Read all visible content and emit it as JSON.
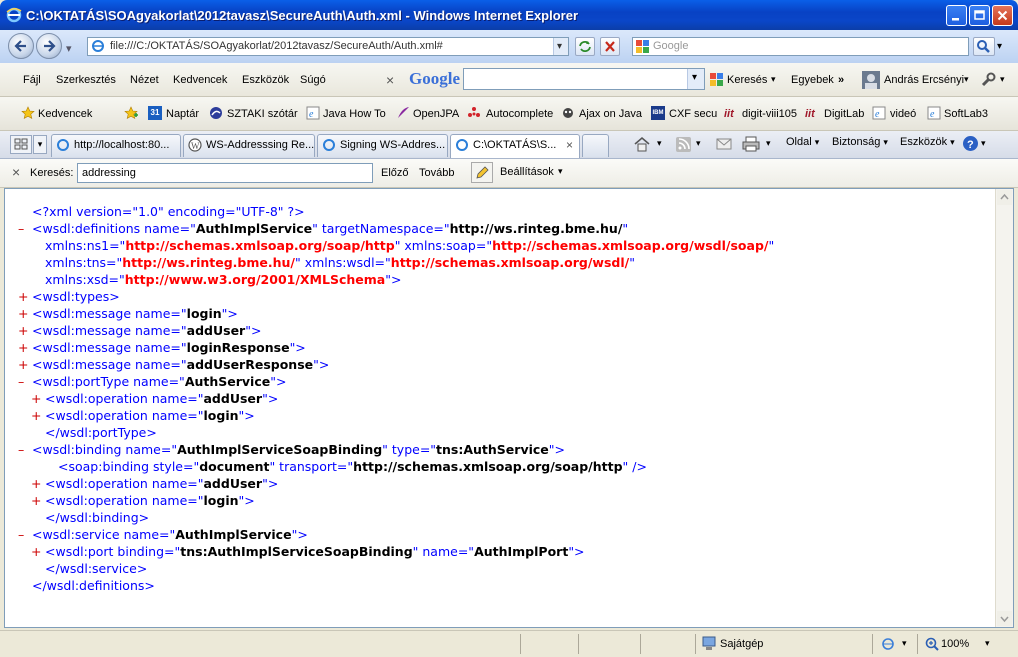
{
  "window": {
    "title": "C:\\OKTATÁS\\SOAgyakorlat\\2012tavasz\\SecureAuth\\Auth.xml - Windows Internet Explorer"
  },
  "address": {
    "url": "file:///C:/OKTATÁS/SOAgyakorlat/2012tavasz/SecureAuth/Auth.xml#",
    "search_placeholder": "Google"
  },
  "menu": {
    "items": [
      "Fájl",
      "Szerkesztés",
      "Nézet",
      "Kedvencek",
      "Eszközök",
      "Súgó"
    ],
    "google_logo": "Google",
    "search_button": "Keresés",
    "more_button": "Egyebek",
    "user_name": "András Ercsényi"
  },
  "favorites": {
    "label": "Kedvencek",
    "items": [
      "Naptár",
      "SZTAKI szótár",
      "Java How To",
      "OpenJPA",
      "Autocomplete",
      "Ajax on Java",
      "CXF secu",
      "digit-viii105",
      "DigitLab",
      "videó",
      "SoftLab3"
    ],
    "calendar_day": "31",
    "ibm_badge": "IBM"
  },
  "tabs": {
    "items": [
      "http://localhost:80...",
      "WS-Addresssing Re...",
      "Signing WS-Addres...",
      "C:\\OKTATÁS\\S..."
    ],
    "toolbar": [
      "Oldal",
      "Biztonság",
      "Eszközök"
    ]
  },
  "find": {
    "label": "Keresés:",
    "value": "addressing",
    "prev": "Előző",
    "next": "Tovább",
    "settings": "Beállítások"
  },
  "xml_lines": [
    {
      "indent": 0,
      "marker": "",
      "parts": [
        {
          "c": "b",
          "t": "<?xml version=\"1.0\" encoding=\"UTF-8\" ?>"
        }
      ]
    },
    {
      "indent": 0,
      "marker": "–",
      "parts": [
        {
          "c": "b",
          "t": "<wsdl:definitions name=\""
        },
        {
          "c": "v",
          "t": "AuthImplService"
        },
        {
          "c": "b",
          "t": "\" targetNamespace=\""
        },
        {
          "c": "v",
          "t": "http://ws.rinteg.bme.hu/"
        },
        {
          "c": "b",
          "t": "\""
        }
      ]
    },
    {
      "indent": 1,
      "marker": "",
      "parts": [
        {
          "c": "b",
          "t": "xmlns:ns1=\""
        },
        {
          "c": "vr",
          "t": "http://schemas.xmlsoap.org/soap/http"
        },
        {
          "c": "b",
          "t": "\" xmlns:soap=\""
        },
        {
          "c": "vr",
          "t": "http://schemas.xmlsoap.org/wsdl/soap/"
        },
        {
          "c": "b",
          "t": "\""
        }
      ]
    },
    {
      "indent": 1,
      "marker": "",
      "parts": [
        {
          "c": "b",
          "t": "xmlns:tns=\""
        },
        {
          "c": "vr",
          "t": "http://ws.rinteg.bme.hu/"
        },
        {
          "c": "b",
          "t": "\" xmlns:wsdl=\""
        },
        {
          "c": "vr",
          "t": "http://schemas.xmlsoap.org/wsdl/"
        },
        {
          "c": "b",
          "t": "\""
        }
      ]
    },
    {
      "indent": 1,
      "marker": "",
      "parts": [
        {
          "c": "b",
          "t": "xmlns:xsd=\""
        },
        {
          "c": "vr",
          "t": "http://www.w3.org/2001/XMLSchema"
        },
        {
          "c": "b",
          "t": "\">"
        }
      ]
    },
    {
      "indent": 0,
      "marker": "+",
      "parts": [
        {
          "c": "b",
          "t": "<wsdl:types>"
        }
      ]
    },
    {
      "indent": 0,
      "marker": "+",
      "parts": [
        {
          "c": "b",
          "t": "<wsdl:message name=\""
        },
        {
          "c": "v",
          "t": "login"
        },
        {
          "c": "b",
          "t": "\">"
        }
      ]
    },
    {
      "indent": 0,
      "marker": "+",
      "parts": [
        {
          "c": "b",
          "t": "<wsdl:message name=\""
        },
        {
          "c": "v",
          "t": "addUser"
        },
        {
          "c": "b",
          "t": "\">"
        }
      ]
    },
    {
      "indent": 0,
      "marker": "+",
      "parts": [
        {
          "c": "b",
          "t": "<wsdl:message name=\""
        },
        {
          "c": "v",
          "t": "loginResponse"
        },
        {
          "c": "b",
          "t": "\">"
        }
      ]
    },
    {
      "indent": 0,
      "marker": "+",
      "parts": [
        {
          "c": "b",
          "t": "<wsdl:message name=\""
        },
        {
          "c": "v",
          "t": "addUserResponse"
        },
        {
          "c": "b",
          "t": "\">"
        }
      ]
    },
    {
      "indent": 0,
      "marker": "–",
      "parts": [
        {
          "c": "b",
          "t": "<wsdl:portType name=\""
        },
        {
          "c": "v",
          "t": "AuthService"
        },
        {
          "c": "b",
          "t": "\">"
        }
      ]
    },
    {
      "indent": 1,
      "marker": "+",
      "parts": [
        {
          "c": "b",
          "t": "<wsdl:operation name=\""
        },
        {
          "c": "v",
          "t": "addUser"
        },
        {
          "c": "b",
          "t": "\">"
        }
      ]
    },
    {
      "indent": 1,
      "marker": "+",
      "parts": [
        {
          "c": "b",
          "t": "<wsdl:operation name=\""
        },
        {
          "c": "v",
          "t": "login"
        },
        {
          "c": "b",
          "t": "\">"
        }
      ]
    },
    {
      "indent": 1,
      "marker": "",
      "parts": [
        {
          "c": "b",
          "t": "</wsdl:portType>"
        }
      ]
    },
    {
      "indent": 0,
      "marker": "–",
      "parts": [
        {
          "c": "b",
          "t": "<wsdl:binding name=\""
        },
        {
          "c": "v",
          "t": "AuthImplServiceSoapBinding"
        },
        {
          "c": "b",
          "t": "\" type=\""
        },
        {
          "c": "v",
          "t": "tns:AuthService"
        },
        {
          "c": "b",
          "t": "\">"
        }
      ]
    },
    {
      "indent": 2,
      "marker": "",
      "parts": [
        {
          "c": "b",
          "t": "<soap:binding style=\""
        },
        {
          "c": "v",
          "t": "document"
        },
        {
          "c": "b",
          "t": "\" transport=\""
        },
        {
          "c": "v",
          "t": "http://schemas.xmlsoap.org/soap/http"
        },
        {
          "c": "b",
          "t": "\" />"
        }
      ]
    },
    {
      "indent": 1,
      "marker": "+",
      "parts": [
        {
          "c": "b",
          "t": "<wsdl:operation name=\""
        },
        {
          "c": "v",
          "t": "addUser"
        },
        {
          "c": "b",
          "t": "\">"
        }
      ]
    },
    {
      "indent": 1,
      "marker": "+",
      "parts": [
        {
          "c": "b",
          "t": "<wsdl:operation name=\""
        },
        {
          "c": "v",
          "t": "login"
        },
        {
          "c": "b",
          "t": "\">"
        }
      ]
    },
    {
      "indent": 1,
      "marker": "",
      "parts": [
        {
          "c": "b",
          "t": "</wsdl:binding>"
        }
      ]
    },
    {
      "indent": 0,
      "marker": "–",
      "parts": [
        {
          "c": "b",
          "t": "<wsdl:service name=\""
        },
        {
          "c": "v",
          "t": "AuthImplService"
        },
        {
          "c": "b",
          "t": "\">"
        }
      ]
    },
    {
      "indent": 1,
      "marker": "+",
      "parts": [
        {
          "c": "b",
          "t": "<wsdl:port binding=\""
        },
        {
          "c": "v",
          "t": "tns:AuthImplServiceSoapBinding"
        },
        {
          "c": "b",
          "t": "\" name=\""
        },
        {
          "c": "v",
          "t": "AuthImplPort"
        },
        {
          "c": "b",
          "t": "\">"
        }
      ]
    },
    {
      "indent": 1,
      "marker": "",
      "parts": [
        {
          "c": "b",
          "t": "</wsdl:service>"
        }
      ]
    },
    {
      "indent": 0,
      "marker": "",
      "parts": [
        {
          "c": "b",
          "t": "</wsdl:definitions>"
        }
      ]
    }
  ],
  "status": {
    "zone": "Sajátgép",
    "zoom": "100%"
  }
}
